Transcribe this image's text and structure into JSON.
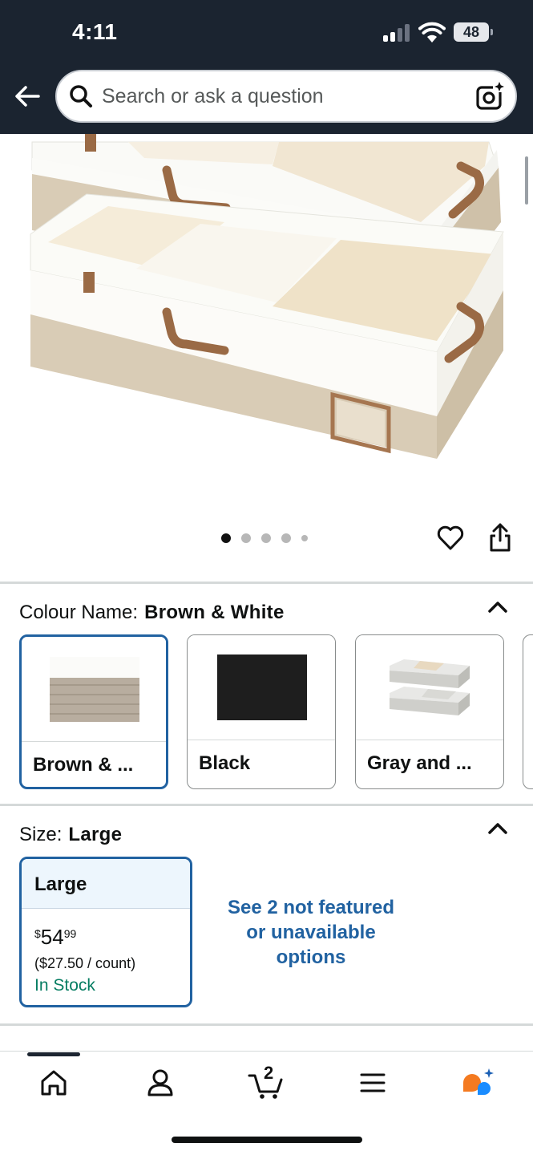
{
  "status_bar": {
    "time": "4:11",
    "battery": "48"
  },
  "header": {
    "search_placeholder": "Search or ask a question"
  },
  "product": {
    "image_count": 5,
    "active_image": 1
  },
  "colour": {
    "label": "Colour Name:",
    "selected": "Brown & White",
    "options": [
      {
        "label": "Brown & ...",
        "selected": true
      },
      {
        "label": "Black",
        "selected": false
      },
      {
        "label": "Gray and ...",
        "selected": false
      }
    ]
  },
  "size": {
    "label": "Size:",
    "selected": "Large",
    "option": {
      "name": "Large",
      "price_symbol": "$",
      "price_whole": "54",
      "price_fraction": "99",
      "unit_price": "($27.50 / count)",
      "availability": "In Stock"
    },
    "more_options_link": "See 2 not featured or unavailable options"
  },
  "bottom_nav": {
    "cart_count": "2",
    "items": [
      "home-icon",
      "account-icon",
      "cart-icon",
      "menu-icon",
      "rufus-ai-icon"
    ]
  },
  "colors": {
    "header_bg": "#1b2430",
    "link_blue": "#2162a1",
    "in_stock_green": "#067d62",
    "ai_orange": "#f47a20",
    "ai_blue": "#1a8cff"
  }
}
